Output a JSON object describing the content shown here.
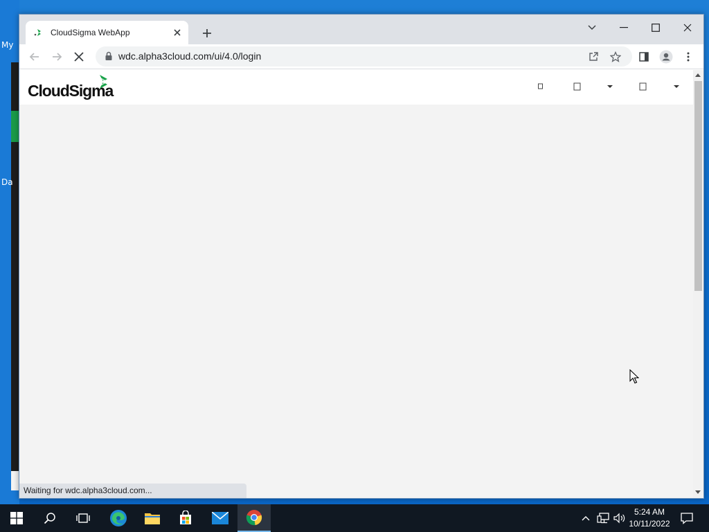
{
  "desktop": {
    "icon_labels": [
      "My",
      "Da"
    ]
  },
  "browser": {
    "tab": {
      "title": "CloudSigma WebApp",
      "favicon": "cloudsigma-favicon-icon",
      "close_icon": "close-icon"
    },
    "new_tab_icon": "plus-icon",
    "window_controls": [
      "tab-search-icon",
      "minimize-icon",
      "maximize-icon",
      "close-icon"
    ],
    "toolbar": {
      "back_icon": "arrow-left-icon",
      "forward_icon": "arrow-right-icon",
      "reload_icon": "stop-loading-icon",
      "url": "wdc.alpha3cloud.com/ui/4.0/login",
      "omnibox_icons": [
        "share-icon",
        "bookmark-star-icon"
      ],
      "right_icons": [
        "side-panel-icon",
        "profile-icon",
        "kebab-menu-icon"
      ]
    },
    "status_text": "Waiting for wdc.alpha3cloud.com..."
  },
  "page": {
    "logo_text": "CloudSigma",
    "brand_color": "#1aa34a",
    "background": "#f3f3f3",
    "header_icons": [
      "placeholder-icon",
      "placeholder-icon",
      "dropdown-caret-icon",
      "placeholder-icon",
      "dropdown-caret-icon"
    ]
  },
  "taskbar": {
    "apps": [
      "windows-start-icon",
      "search-icon",
      "task-view-icon",
      "edge-icon",
      "file-explorer-icon",
      "store-icon",
      "mail-icon",
      "chrome-icon"
    ],
    "active_app": "chrome-icon",
    "tray_icons": [
      "chevron-up-icon",
      "network-icon",
      "volume-icon"
    ],
    "clock": {
      "time": "5:24 AM",
      "date": "10/11/2022"
    },
    "notification_icon": "notification-icon"
  }
}
